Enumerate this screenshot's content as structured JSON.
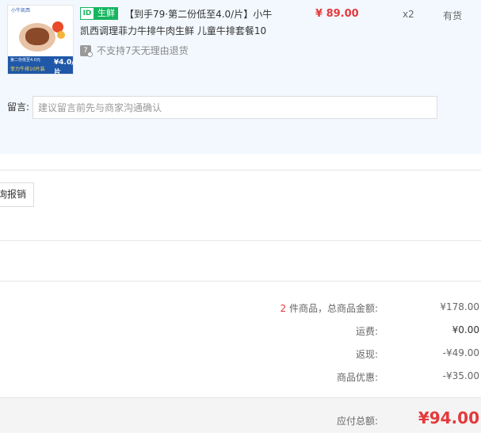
{
  "product": {
    "thumb": {
      "brand": "小牛凯西",
      "promo_line1": "第二份低至4.0元",
      "promo_line2": "菲力牛排10片装",
      "price_tag": "¥4.0/片"
    },
    "tag_logo": "ID",
    "tag_label": "生鲜",
    "title_line1": "【到手79·第二份低至4.0/片】小牛",
    "title_line2": "凯西调理菲力牛排牛肉生鲜 儿童牛排套餐10",
    "return_icon_text": "7",
    "return_policy": "不支持7天无理由退货",
    "price": "¥ 89.00",
    "quantity": "x2",
    "stock": "有货"
  },
  "note": {
    "label": "留言:",
    "placeholder": "建议留言前先与商家沟通确认"
  },
  "invoice_button": "询报销",
  "summary": {
    "count": "2",
    "goods_label": "件商品，总商品金额:",
    "goods_value": "¥178.00",
    "shipping_label": "运费:",
    "shipping_value": "¥0.00",
    "cashback_label": "返现:",
    "cashback_value": "-¥49.00",
    "discount_label": "商品优惠:",
    "discount_value": "-¥35.00",
    "payable_label": "应付总额:",
    "payable_value": "¥94.00"
  },
  "colors": {
    "accent_red": "#e4393c",
    "fresh_green": "#16b55f",
    "panel_bg": "#f3f8fe"
  }
}
